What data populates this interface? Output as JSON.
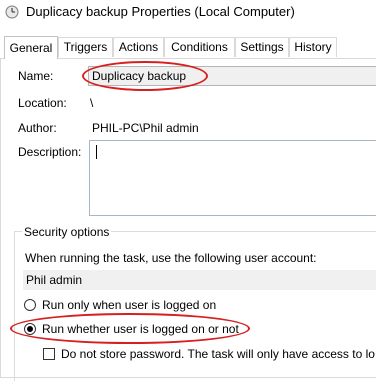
{
  "window": {
    "title": "Duplicacy backup Properties (Local Computer)",
    "icon": "clock-task-icon"
  },
  "tabs": [
    {
      "label": "General",
      "selected": true
    },
    {
      "label": "Triggers",
      "selected": false
    },
    {
      "label": "Actions",
      "selected": false
    },
    {
      "label": "Conditions",
      "selected": false
    },
    {
      "label": "Settings",
      "selected": false
    },
    {
      "label": "History",
      "selected": false
    }
  ],
  "general": {
    "name_label": "Name:",
    "name_value": "Duplicacy backup",
    "location_label": "Location:",
    "location_value": "\\",
    "author_label": "Author:",
    "author_value": "PHIL-PC\\Phil admin",
    "description_label": "Description:",
    "description_value": ""
  },
  "security": {
    "legend": "Security options",
    "account_prompt": "When running the task, use the following user account:",
    "account_value": "Phil admin",
    "radio_logged_on": {
      "label": "Run only when user is logged on",
      "checked": false
    },
    "radio_whether": {
      "label": "Run whether user is logged on or not",
      "checked": true
    },
    "checkbox_no_password": {
      "label": "Do not store password.  The task will only have access to lo",
      "checked": false
    }
  },
  "annotation_color": "#d81e1e"
}
